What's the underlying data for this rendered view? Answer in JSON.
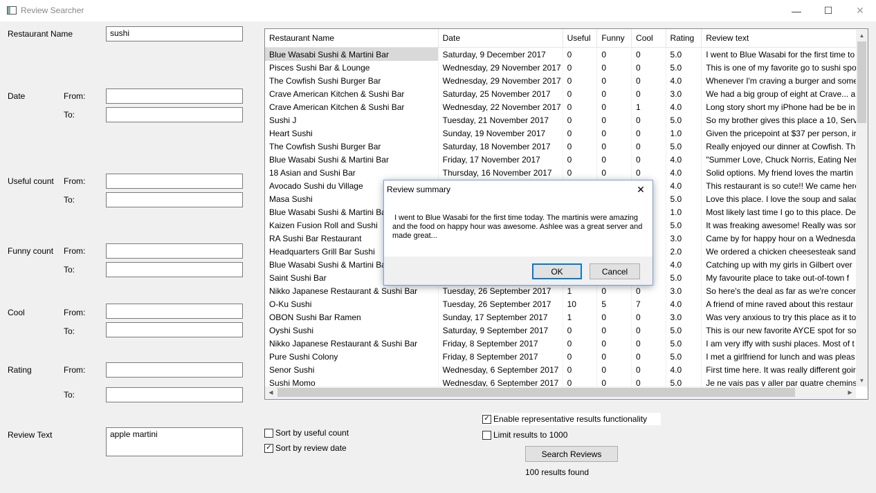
{
  "window": {
    "title": "Review Searcher",
    "minimize": "—",
    "maximize": "☐",
    "close": "✕"
  },
  "form": {
    "restaurant_name_label": "Restaurant Name",
    "restaurant_name_value": "sushi",
    "date_label": "Date",
    "useful_label": "Useful count",
    "funny_label": "Funny count",
    "cool_label": "Cool",
    "rating_label": "Rating",
    "from_label": "From:",
    "to_label": "To:",
    "review_text_label": "Review Text",
    "review_text_value": "apple martini"
  },
  "options": {
    "sort_useful": "Sort by useful count",
    "sort_useful_checked": false,
    "sort_date": "Sort by review date",
    "sort_date_checked": true,
    "representative": "Enable representative results functionality",
    "representative_checked": true,
    "limit": "Limit results to 1000",
    "limit_checked": false,
    "search_button": "Search Reviews",
    "results_found": "100 results found"
  },
  "table": {
    "columns": [
      "Restaurant Name",
      "Date",
      "Useful",
      "Funny",
      "Cool",
      "Rating",
      "Review text"
    ],
    "rows": [
      [
        "Blue Wasabi Sushi & Martini Bar",
        "Saturday, 9 December 2017",
        "0",
        "0",
        "0",
        "5.0",
        "I went to Blue Wasabi for the first time to"
      ],
      [
        "Pisces Sushi Bar & Lounge",
        "Wednesday, 29 November 2017",
        "0",
        "0",
        "0",
        "5.0",
        "This is one of my favorite go to sushi spo"
      ],
      [
        "The Cowfish Sushi Burger Bar",
        "Wednesday, 29 November 2017",
        "0",
        "0",
        "0",
        "4.0",
        "Whenever I'm craving a burger and some"
      ],
      [
        "Crave American Kitchen & Sushi Bar",
        "Saturday, 25 November 2017",
        "0",
        "0",
        "0",
        "3.0",
        "We had a big group of eight at Crave... a"
      ],
      [
        "Crave American Kitchen & Sushi Bar",
        "Wednesday, 22 November 2017",
        "0",
        "0",
        "1",
        "4.0",
        "Long story short my iPhone had be be in"
      ],
      [
        "Sushi J",
        "Tuesday, 21 November 2017",
        "0",
        "0",
        "0",
        "5.0",
        "So my brother gives this place a 10, Servi"
      ],
      [
        "Heart Sushi",
        "Sunday, 19 November 2017",
        "0",
        "0",
        "0",
        "1.0",
        "Given the pricepoint at $37 per person, ir"
      ],
      [
        "The Cowfish Sushi Burger Bar",
        "Saturday, 18 November 2017",
        "0",
        "0",
        "0",
        "5.0",
        "Really enjoyed our dinner at Cowfish. Th"
      ],
      [
        "Blue Wasabi Sushi & Martini Bar",
        "Friday, 17 November 2017",
        "0",
        "0",
        "0",
        "4.0",
        "\"Summer Love, Chuck Norris, Eating Ner"
      ],
      [
        "18 Asian and Sushi Bar",
        "Thursday, 16 November 2017",
        "0",
        "0",
        "0",
        "4.0",
        "Solid options. My friend loves the martin"
      ],
      [
        "Avocado Sushi du Village",
        "",
        "",
        "",
        "",
        "4.0",
        "This restaurant is so cute!! We came here"
      ],
      [
        "Masa Sushi",
        "",
        "",
        "",
        "",
        "5.0",
        "Love this place. I love the soup and salad"
      ],
      [
        "Blue Wasabi Sushi & Martini Bar",
        "",
        "",
        "",
        "",
        "1.0",
        "Most likely last time I go to this place. De"
      ],
      [
        "Kaizen Fusion Roll and Sushi",
        "",
        "",
        "",
        "",
        "5.0",
        "It was freaking awesome! Really was som"
      ],
      [
        "RA Sushi Bar Restaurant",
        "",
        "",
        "",
        "",
        "3.0",
        "Came by for happy hour on a Wednesda"
      ],
      [
        "Headquarters Grill Bar Sushi",
        "",
        "",
        "",
        "",
        "2.0",
        "We ordered a chicken cheesesteak sandv"
      ],
      [
        "Blue Wasabi Sushi & Martini Bar",
        "",
        "",
        "",
        "",
        "4.0",
        "Catching up with my girls in Gilbert over"
      ],
      [
        "Saint Sushi Bar",
        "",
        "",
        "",
        "",
        "5.0",
        "My favourite place to take out-of-town f"
      ],
      [
        "Nikko Japanese Restaurant & Sushi Bar",
        "Tuesday, 26 September 2017",
        "1",
        "0",
        "0",
        "3.0",
        "So here's the deal as far as we're concern"
      ],
      [
        "O-Ku Sushi",
        "Tuesday, 26 September 2017",
        "10",
        "5",
        "7",
        "4.0",
        "A friend of mine raved about this restaur"
      ],
      [
        "OBON Sushi Bar Ramen",
        "Sunday, 17 September 2017",
        "1",
        "0",
        "0",
        "3.0",
        "Was very anxious to try this place as it to"
      ],
      [
        "Oyshi Sushi",
        "Saturday, 9 September 2017",
        "0",
        "0",
        "0",
        "5.0",
        "This is our new favorite AYCE spot for so"
      ],
      [
        "Nikko Japanese Restaurant & Sushi Bar",
        "Friday, 8 September 2017",
        "0",
        "0",
        "0",
        "5.0",
        "I am very iffy with sushi places. Most of t"
      ],
      [
        "Pure Sushi Colony",
        "Friday, 8 September 2017",
        "0",
        "0",
        "0",
        "5.0",
        "I met a girlfriend for lunch and was pleas"
      ],
      [
        "Senor Sushi",
        "Wednesday, 6 September 2017",
        "0",
        "0",
        "0",
        "4.0",
        "First time here. It was really different goir"
      ],
      [
        "Sushi Momo",
        "Wednesday, 6 September 2017",
        "0",
        "0",
        "0",
        "5.0",
        "Je ne vais pas y aller par quatre chemins:"
      ]
    ]
  },
  "dialog": {
    "title": "Review summary",
    "close": "✕",
    "message": " I went to Blue Wasabi for the first time today. The martinis were amazing and the food on happy hour was awesome. Ashlee was a great server and made great...",
    "ok": "OK",
    "cancel": "Cancel"
  },
  "icons": {
    "scroll_up": "▲",
    "scroll_down": "▼",
    "scroll_left": "◀",
    "scroll_right": "▶"
  }
}
